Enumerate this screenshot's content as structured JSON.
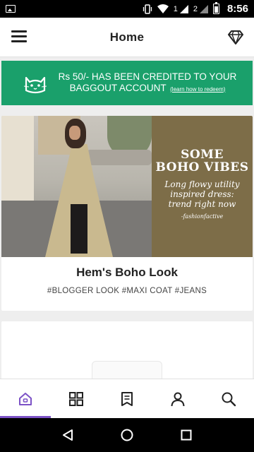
{
  "status_bar": {
    "sim1": "1",
    "sim2": "2",
    "time": "8:56"
  },
  "app_bar": {
    "title": "Home",
    "menu_icon": "hamburger-menu-icon",
    "right_icon": "diamond-icon"
  },
  "credit_banner": {
    "icon": "cat-icon",
    "message": "Rs 50/- HAS BEEN CREDITED TO YOUR BAGGOUT ACCOUNT",
    "link_text": "(learn how to redeem)",
    "background": "#1aa06b"
  },
  "feature_card": {
    "image_title_line1": "SOME",
    "image_title_line2": "BOHO VIBES",
    "image_subtitle": "Long flowy utility inspired dress: trend right now",
    "image_credit": "-fashionfactive",
    "title": "Hem's Boho Look",
    "tags": "#BLOGGER LOOK #MAXI COAT #JEANS"
  },
  "bottom_nav": {
    "tabs": [
      {
        "icon": "home-icon",
        "active": true
      },
      {
        "icon": "grid-icon",
        "active": false
      },
      {
        "icon": "bookmark-list-icon",
        "active": false
      },
      {
        "icon": "profile-icon",
        "active": false
      },
      {
        "icon": "search-icon",
        "active": false
      }
    ],
    "accent": "#7c52c6"
  },
  "system_nav": {
    "back_icon": "back-triangle-icon",
    "home_icon": "home-circle-icon",
    "recents_icon": "recents-square-icon"
  }
}
